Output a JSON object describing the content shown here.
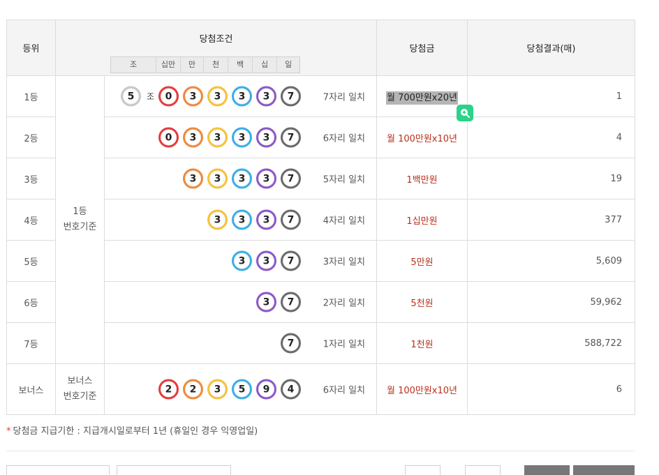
{
  "header": {
    "rank": "등위",
    "condition": "당첨조건",
    "prize": "당첨금",
    "result": "당첨결과(매)",
    "units": [
      "조",
      "십만",
      "만",
      "천",
      "백",
      "십",
      "일"
    ]
  },
  "basis": {
    "first_line1": "1등",
    "first_line2": "번호기준",
    "bonus_line1": "보너스",
    "bonus_line2": "번호기준"
  },
  "jo_label": "조",
  "rows": [
    {
      "rank": "1등",
      "jo": "5",
      "balls": [
        "0",
        "3",
        "3",
        "3",
        "3",
        "7"
      ],
      "colors": [
        "red",
        "orange",
        "yellow",
        "blue",
        "purple",
        "gray"
      ],
      "match": "7자리 일치",
      "prize": "월 700만원x20년",
      "count": "1"
    },
    {
      "rank": "2등",
      "balls": [
        "0",
        "3",
        "3",
        "3",
        "3",
        "7"
      ],
      "colors": [
        "red",
        "orange",
        "yellow",
        "blue",
        "purple",
        "gray"
      ],
      "match": "6자리 일치",
      "prize": "월 100만원x10년",
      "count": "4"
    },
    {
      "rank": "3등",
      "balls": [
        "3",
        "3",
        "3",
        "3",
        "7"
      ],
      "colors": [
        "orange",
        "yellow",
        "blue",
        "purple",
        "gray"
      ],
      "match": "5자리 일치",
      "prize": "1백만원",
      "count": "19"
    },
    {
      "rank": "4등",
      "balls": [
        "3",
        "3",
        "3",
        "7"
      ],
      "colors": [
        "yellow",
        "blue",
        "purple",
        "gray"
      ],
      "match": "4자리 일치",
      "prize": "1십만원",
      "count": "377"
    },
    {
      "rank": "5등",
      "balls": [
        "3",
        "3",
        "7"
      ],
      "colors": [
        "blue",
        "purple",
        "gray"
      ],
      "match": "3자리 일치",
      "prize": "5만원",
      "count": "5,609"
    },
    {
      "rank": "6등",
      "balls": [
        "3",
        "7"
      ],
      "colors": [
        "purple",
        "gray"
      ],
      "match": "2자리 일치",
      "prize": "5천원",
      "count": "59,962"
    },
    {
      "rank": "7등",
      "balls": [
        "7"
      ],
      "colors": [
        "gray"
      ],
      "match": "1자리 일치",
      "prize": "1천원",
      "count": "588,722"
    },
    {
      "rank": "보너스",
      "balls": [
        "2",
        "2",
        "3",
        "5",
        "9",
        "4"
      ],
      "colors": [
        "red",
        "orange",
        "yellow",
        "blue",
        "purple",
        "gray"
      ],
      "match": "6자리 일치",
      "prize": "월 100만원x10년",
      "count": "6"
    }
  ],
  "note": {
    "star": "*",
    "text": "당첨금 지급기한 : 지급개시일로부터 1년 (휴일인 경우 익영업일)"
  },
  "icons": {
    "zoom": "zoom-in-icon"
  },
  "colors": {
    "prize_text": "#b9301a",
    "zoom_badge": "#2bd28a",
    "ball_red": "#e63b3b",
    "ball_orange": "#f0893a",
    "ball_yellow": "#f6c23c",
    "ball_blue": "#3aaee8",
    "ball_purple": "#8c57c9",
    "ball_gray": "#6a6a6a"
  }
}
